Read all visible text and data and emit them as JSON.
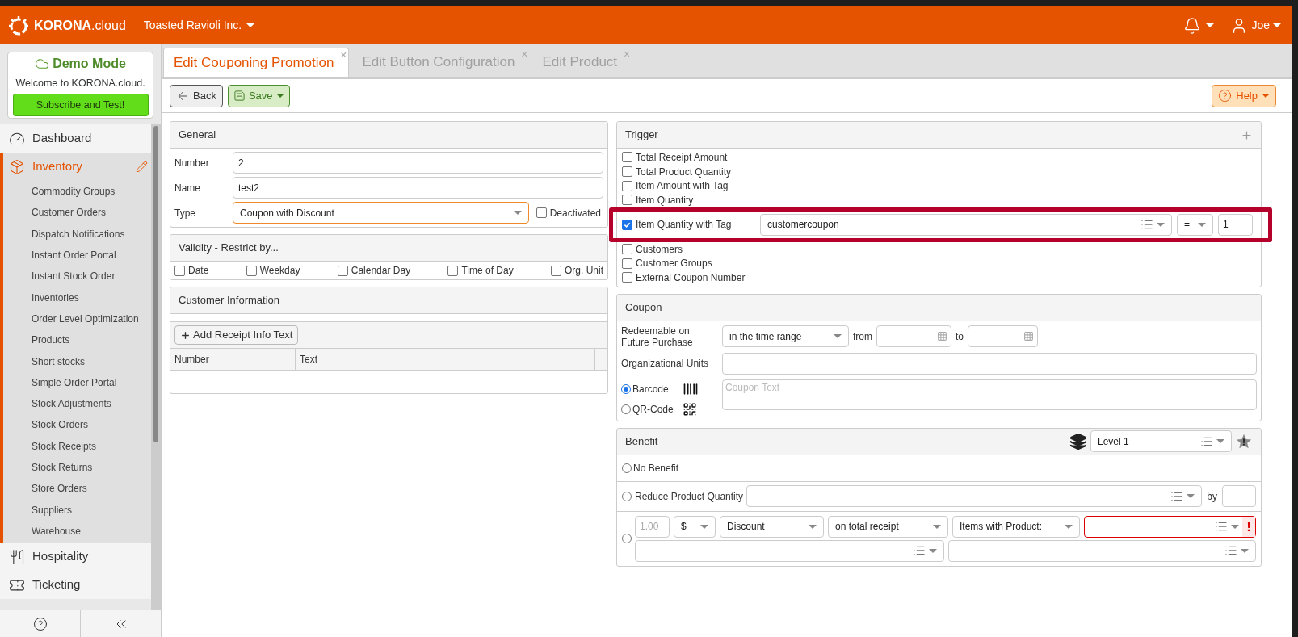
{
  "header": {
    "brand": "KORONA",
    "brand_suffix": ".cloud",
    "company": "Toasted Ravioli Inc.",
    "user": "Joe"
  },
  "demo": {
    "title": "Demo Mode",
    "welcome": "Welcome to KORONA.cloud.",
    "button": "Subscribe and Test!"
  },
  "sidebar": {
    "items": [
      {
        "label": "Dashboard",
        "selected": false
      },
      {
        "label": "Inventory",
        "selected": true,
        "children": [
          {
            "label": "Commodity Groups"
          },
          {
            "label": "Customer Orders"
          },
          {
            "label": "Dispatch Notifications"
          },
          {
            "label": "Instant Order Portal"
          },
          {
            "label": "Instant Stock Order"
          },
          {
            "label": "Inventories"
          },
          {
            "label": "Order Level Optimization"
          },
          {
            "label": "Products"
          },
          {
            "label": "Short stocks"
          },
          {
            "label": "Simple Order Portal"
          },
          {
            "label": "Stock Adjustments"
          },
          {
            "label": "Stock Orders"
          },
          {
            "label": "Stock Receipts"
          },
          {
            "label": "Stock Returns"
          },
          {
            "label": "Store Orders"
          },
          {
            "label": "Suppliers"
          },
          {
            "label": "Warehouse"
          }
        ]
      },
      {
        "label": "Hospitality",
        "selected": false
      },
      {
        "label": "Ticketing",
        "selected": false
      }
    ]
  },
  "tabs": [
    {
      "label": "Edit Couponing Promotion",
      "selected": true,
      "close": "×"
    },
    {
      "label": "Edit Button Configuration",
      "selected": false,
      "close": "×"
    },
    {
      "label": "Edit Product",
      "selected": false,
      "close": "×"
    }
  ],
  "toolbar": {
    "back": "Back",
    "save": "Save",
    "help": "Help"
  },
  "general": {
    "title": "General",
    "fields": [
      {
        "label": "Number",
        "value": "2",
        "kind": "text"
      },
      {
        "label": "Name",
        "value": "test2",
        "kind": "text"
      },
      {
        "label": "Type",
        "value": "Coupon with Discount",
        "kind": "select"
      }
    ],
    "deactivated": {
      "label": "Deactivated",
      "checked": false
    }
  },
  "validity": {
    "title": "Validity - Restrict by...",
    "options": [
      {
        "label": "Date",
        "checked": false
      },
      {
        "label": "Weekday",
        "checked": false
      },
      {
        "label": "Calendar Day",
        "checked": false
      },
      {
        "label": "Time of Day",
        "checked": false
      },
      {
        "label": "Org. Unit",
        "checked": false
      }
    ]
  },
  "customer_info": {
    "title": "Customer Information",
    "add_button": "Add Receipt Info Text",
    "columns": [
      "Number",
      "Text"
    ]
  },
  "trigger": {
    "title": "Trigger",
    "items": [
      {
        "label": "Total Receipt Amount",
        "checked": false,
        "highlighted": false
      },
      {
        "label": "Total Product Quantity",
        "checked": false,
        "highlighted": false
      },
      {
        "label": "Item Amount with Tag",
        "checked": false,
        "highlighted": false
      },
      {
        "label": "Item Quantity",
        "checked": false,
        "highlighted": false
      },
      {
        "label": "Item Quantity with Tag",
        "checked": true,
        "highlighted": true,
        "tag": "customercoupon",
        "operator": "=",
        "value": "1"
      },
      {
        "label": "Customers",
        "checked": false,
        "highlighted": false
      },
      {
        "label": "Customer Groups",
        "checked": false,
        "highlighted": false
      },
      {
        "label": "External Coupon Number",
        "checked": false,
        "highlighted": false
      }
    ]
  },
  "coupon": {
    "title": "Coupon",
    "redeem_label": "Redeemable on Future Purchase",
    "redeem_value": "in the time range",
    "from": "from",
    "to": "to",
    "org_units_label": "Organizational Units",
    "code_types": [
      {
        "label": "Barcode",
        "selected": true
      },
      {
        "label": "QR-Code",
        "selected": false
      }
    ],
    "text_placeholder": "Coupon Text"
  },
  "benefit": {
    "title": "Benefit",
    "level": "Level 1",
    "options": [
      {
        "kind": "none",
        "label": "No Benefit",
        "selected": false
      },
      {
        "kind": "reduce",
        "label": "Reduce Product Quantity",
        "by": "by",
        "selected": false
      },
      {
        "kind": "discount",
        "selected": false,
        "amount_placeholder": "1.00",
        "currency": "$",
        "type": "Discount",
        "scope": "on total receipt",
        "target": "Items with Product:",
        "invalid": true,
        "error": "!"
      }
    ]
  }
}
